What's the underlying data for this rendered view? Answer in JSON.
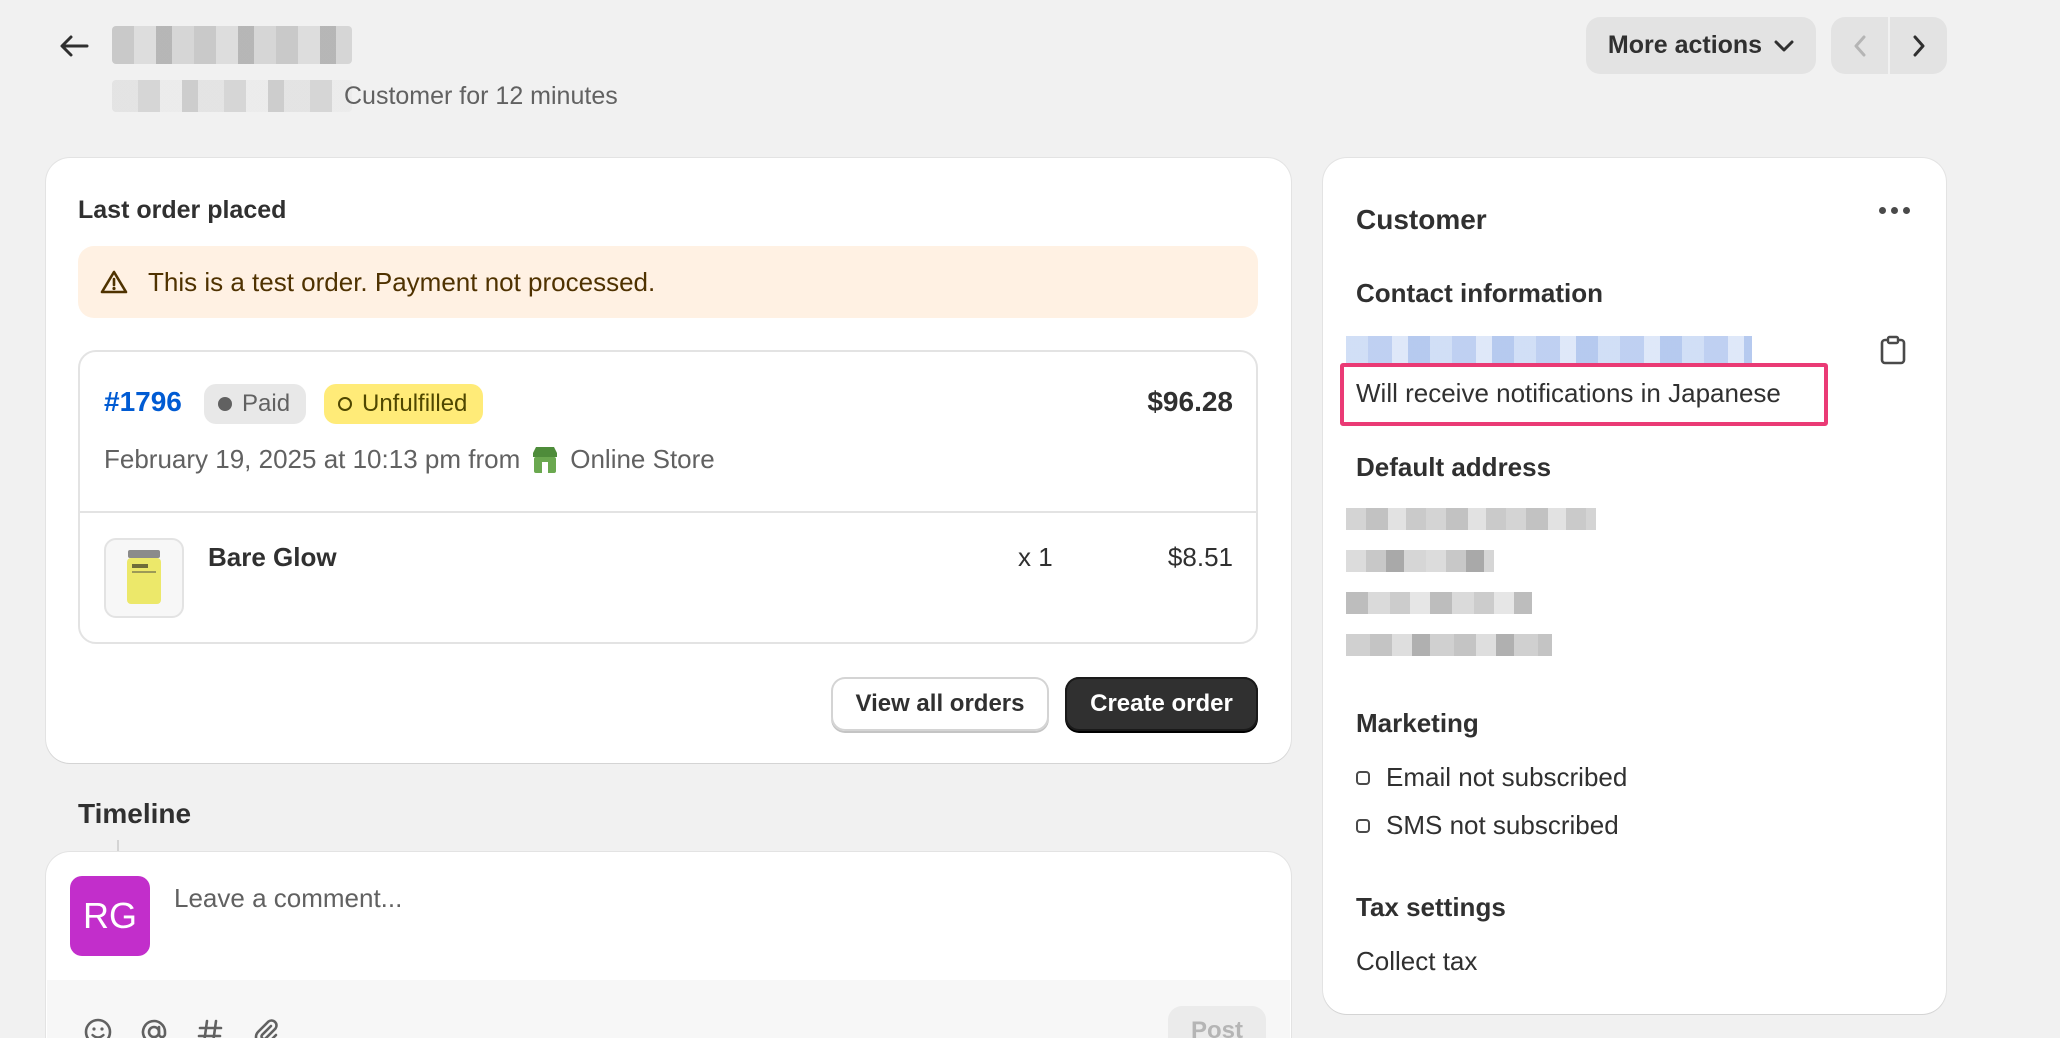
{
  "header": {
    "subtitle": "Customer for 12 minutes",
    "more_actions_label": "More actions"
  },
  "last_order": {
    "title": "Last order placed",
    "banner_text": "This is a test order. Payment not processed.",
    "order_number": "#1796",
    "payment_status": "Paid",
    "fulfillment_status": "Unfulfilled",
    "total": "$96.28",
    "date_text": "February 19, 2025 at 10:13 pm from",
    "channel": "Online Store",
    "item": {
      "name": "Bare Glow",
      "quantity": "x 1",
      "price": "$8.51"
    },
    "view_all_label": "View all orders",
    "create_label": "Create order"
  },
  "timeline": {
    "title": "Timeline",
    "avatar_initials": "RG",
    "comment_placeholder": "Leave a comment...",
    "post_label": "Post"
  },
  "customer": {
    "title": "Customer",
    "contact_heading": "Contact information",
    "notification_text": "Will receive notifications in Japanese",
    "address_heading": "Default address",
    "marketing_heading": "Marketing",
    "email_status": "Email not subscribed",
    "sms_status": "SMS not subscribed",
    "tax_heading": "Tax settings",
    "tax_value": "Collect tax"
  },
  "colors": {
    "accent_link": "#005bd3",
    "highlight_border": "#ea3a75",
    "avatar_bg": "#c22ecb",
    "unfulfilled_badge": "#ffeb78",
    "warning_banner": "#fff1e3"
  }
}
